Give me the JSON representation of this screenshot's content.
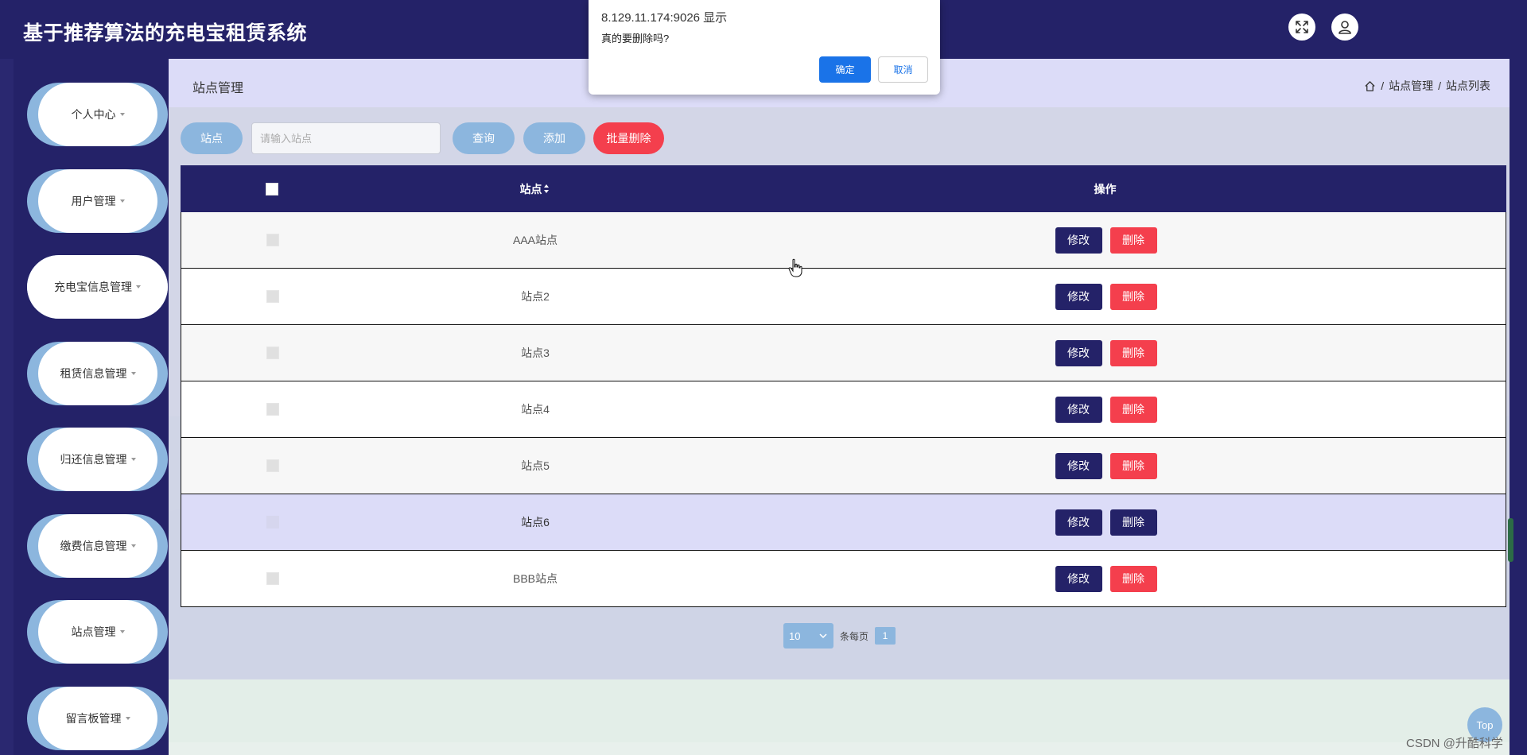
{
  "header": {
    "title": "基于推荐算法的充电宝租赁系统",
    "fullscreen_icon": "fullscreen-icon",
    "user_icon": "user-icon"
  },
  "sidebar": {
    "items": [
      {
        "label": "个人中心"
      },
      {
        "label": "用户管理"
      },
      {
        "label": "充电宝信息管理"
      },
      {
        "label": "租赁信息管理"
      },
      {
        "label": "归还信息管理"
      },
      {
        "label": "缴费信息管理"
      },
      {
        "label": "站点管理"
      },
      {
        "label": "留言板管理"
      }
    ]
  },
  "page": {
    "title": "站点管理",
    "breadcrumb": [
      "站点管理",
      "站点列表"
    ],
    "breadcrumb_sep": "/"
  },
  "toolbar": {
    "tag_label": "站点",
    "search_placeholder": "请输入站点",
    "search_value": "",
    "query_label": "查询",
    "add_label": "添加",
    "batch_delete_label": "批量删除"
  },
  "table": {
    "columns": {
      "name": "站点",
      "actions": "操作"
    },
    "rows": [
      {
        "name": "AAA站点"
      },
      {
        "name": "站点2"
      },
      {
        "name": "站点3"
      },
      {
        "name": "站点4"
      },
      {
        "name": "站点5"
      },
      {
        "name": "站点6"
      },
      {
        "name": "BBB站点"
      }
    ],
    "edit_label": "修改",
    "delete_label": "删除"
  },
  "pagination": {
    "page_size": "10",
    "per_page_text": "条每页",
    "current_page": "1"
  },
  "top_button": "Top",
  "watermark": "CSDN @升酷科学",
  "dialog": {
    "origin": "8.129.11.174:9026 显示",
    "message": "真的要删除吗?",
    "ok_label": "确定",
    "cancel_label": "取消"
  },
  "colors": {
    "navy": "#242268",
    "accent_blue": "#8cb6de",
    "danger_red": "#f43f4d",
    "dialog_blue": "#1a73e8"
  }
}
